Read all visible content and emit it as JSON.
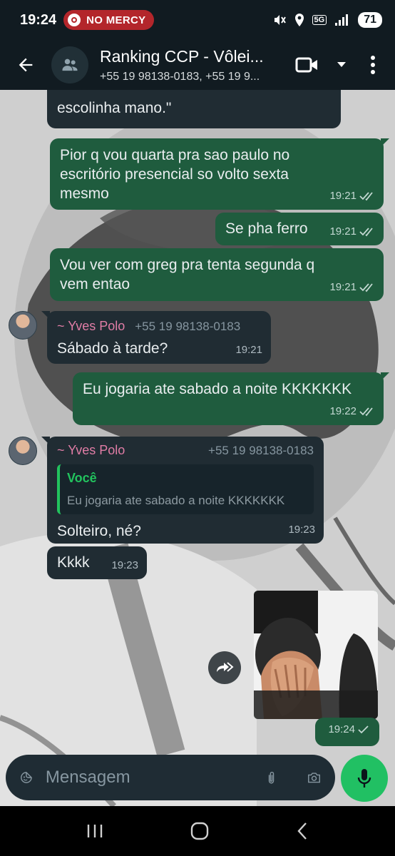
{
  "status_bar": {
    "time": "19:24",
    "pill_text": "NO MERCY",
    "network": "5G",
    "battery": "71"
  },
  "header": {
    "title": "Ranking CCP - Vôlei...",
    "subtitle": "+55 19 98138-0183, +55 19 9..."
  },
  "messages": [
    {
      "type": "in",
      "text": "escolinha mano.\""
    },
    {
      "type": "out",
      "text": "Pior q vou quarta pra sao paulo no escritório presencial so volto sexta mesmo",
      "time": "19:21"
    },
    {
      "type": "out",
      "text": "Se pha ferro",
      "time": "19:21"
    },
    {
      "type": "out",
      "text": "Vou ver com greg pra tenta segunda q vem entao",
      "time": "19:21"
    },
    {
      "type": "in",
      "sender": "~ Yves Polo",
      "phone": "+55 19 98138-0183",
      "text": "Sábado à tarde?",
      "time": "19:21"
    },
    {
      "type": "out",
      "text": "Eu jogaria ate sabado a noite KKKKKKK",
      "time": "19:22"
    },
    {
      "type": "in",
      "sender": "~ Yves Polo",
      "phone": "+55 19 98138-0183",
      "quote_name": "Você",
      "quote_text": "Eu jogaria ate sabado a noite KKKKKKK",
      "text": "Solteiro, né?",
      "time": "19:23"
    },
    {
      "type": "in",
      "text": "Kkkk",
      "time": "19:23"
    },
    {
      "type": "out-image",
      "time": "19:24"
    }
  ],
  "input": {
    "placeholder": "Mensagem"
  },
  "colors": {
    "header_bg": "#111b21",
    "incoming_bubble": "#202c33",
    "outgoing_bubble": "#1f5c3e",
    "accent_green": "#21c063",
    "sender_name": "#e17da6"
  }
}
